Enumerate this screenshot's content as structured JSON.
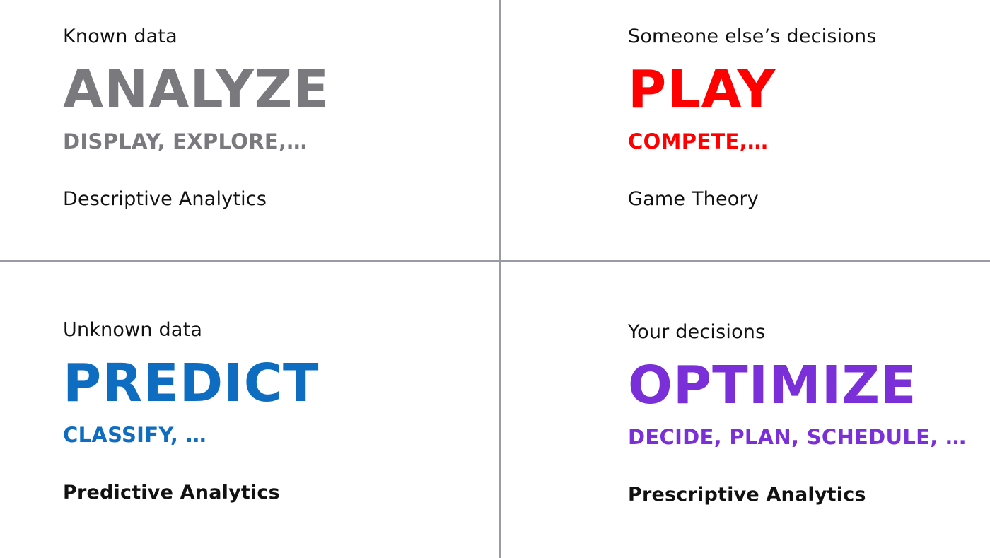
{
  "quadrants": {
    "analyze": {
      "context": "Known data",
      "verb": "ANALYZE",
      "subverbs": "DISPLAY, EXPLORE,…",
      "category": "Descriptive Analytics",
      "color": "#7a7a7e"
    },
    "play": {
      "context": "Someone else’s decisions",
      "verb": "PLAY",
      "subverbs": "COMPETE,…",
      "category": "Game Theory",
      "color": "#ff0000"
    },
    "predict": {
      "context": "Unknown data",
      "verb": "PREDICT",
      "subverbs": "CLASSIFY, …",
      "category": "Predictive Analytics",
      "color": "#0e6cc1"
    },
    "optimize": {
      "context": "Your decisions",
      "verb": "OPTIMIZE",
      "subverbs": "DECIDE, PLAN, SCHEDULE, …",
      "category": "Prescriptive Analytics",
      "color": "#7b2fd9"
    }
  }
}
